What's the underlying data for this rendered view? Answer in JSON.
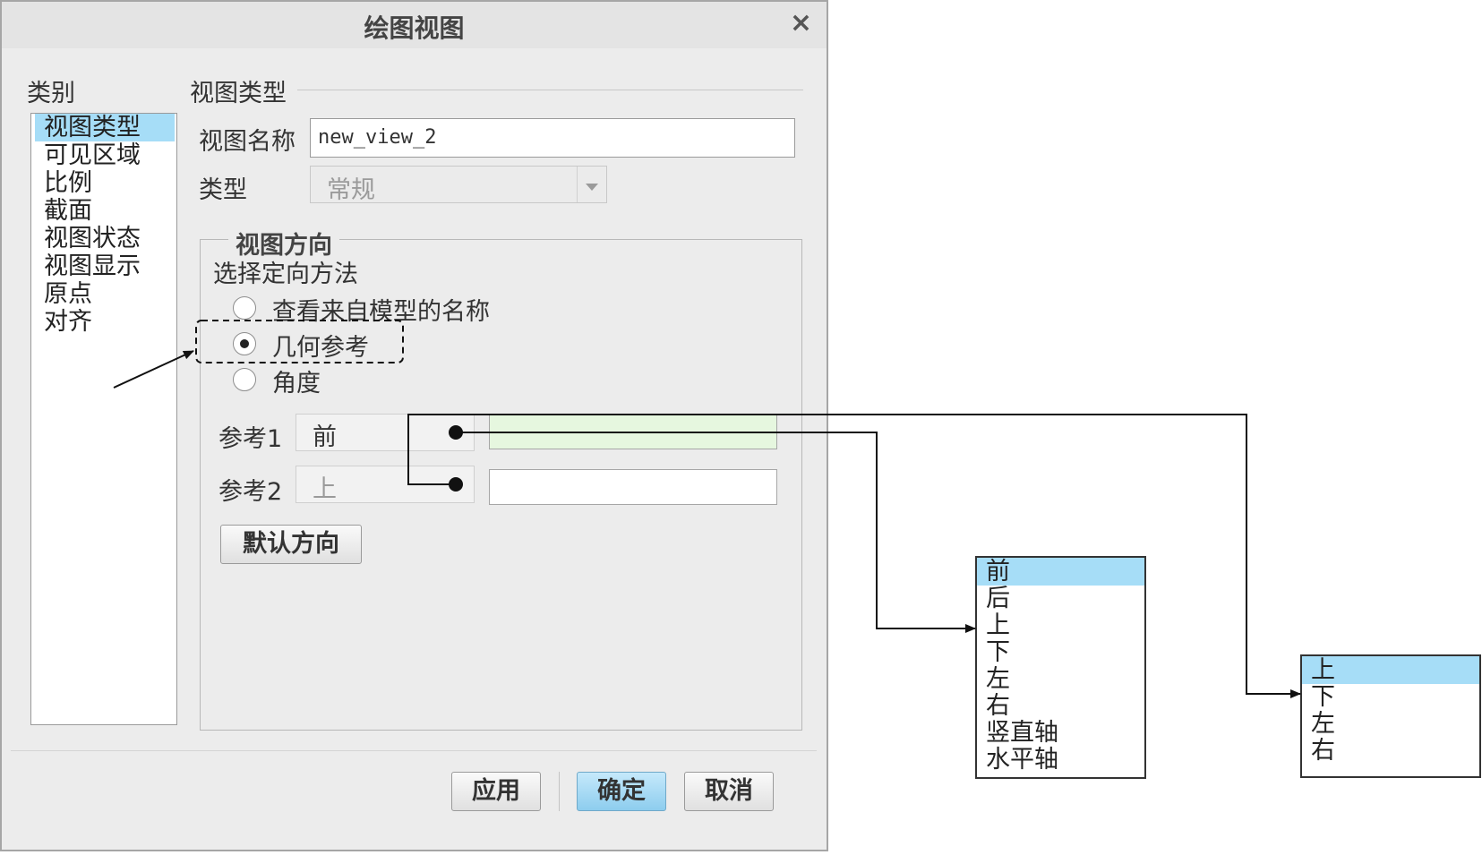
{
  "dialog": {
    "title": "绘图视图",
    "close_glyph": "×",
    "category_label": "类别",
    "categories": [
      {
        "label": "视图类型",
        "selected": true
      },
      {
        "label": "可见区域",
        "selected": false
      },
      {
        "label": "比例",
        "selected": false
      },
      {
        "label": "截面",
        "selected": false
      },
      {
        "label": "视图状态",
        "selected": false
      },
      {
        "label": "视图显示",
        "selected": false
      },
      {
        "label": "原点",
        "selected": false
      },
      {
        "label": "对齐",
        "selected": false
      }
    ],
    "section_title": "视图类型",
    "view_name_label": "视图名称",
    "view_name_value": "new_view_2",
    "type_label": "类型",
    "type_value": "常规",
    "orientation": {
      "group_title": "视图方向",
      "method_label": "选择定向方法",
      "options": [
        {
          "label": "查看来自模型的名称",
          "selected": false
        },
        {
          "label": "几何参考",
          "selected": true
        },
        {
          "label": "角度",
          "selected": false
        }
      ],
      "ref1_label": "参考1",
      "ref1_value": "前",
      "ref2_label": "参考2",
      "ref2_value": "上",
      "ref1_field_color": "#e6f7df",
      "default_button": "默认方向"
    },
    "buttons": {
      "apply": "应用",
      "ok": "确定",
      "cancel": "取消"
    }
  },
  "dropdown_ref1": {
    "items": [
      "前",
      "后",
      "上",
      "下",
      "左",
      "右",
      "竖直轴",
      "水平轴"
    ],
    "selected_index": 0
  },
  "dropdown_ref2": {
    "items": [
      "上",
      "下",
      "左",
      "右"
    ],
    "selected_index": 0
  },
  "colors": {
    "selection": "#a6ddf7",
    "dialog_bg": "#ececec",
    "primary_button": "#8dcdee"
  }
}
